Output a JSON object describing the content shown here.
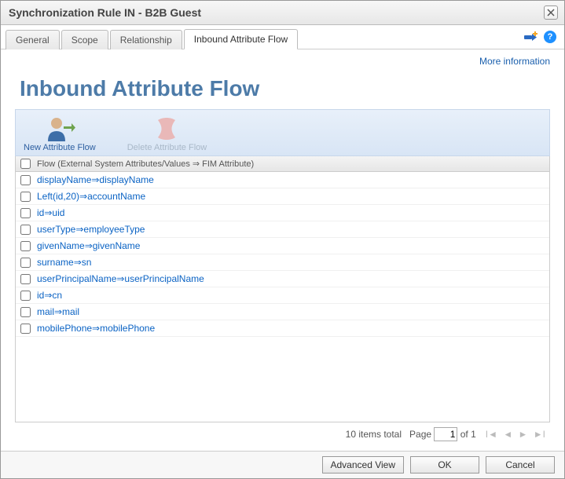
{
  "window": {
    "title": "Synchronization Rule IN - B2B Guest"
  },
  "tabs": [
    {
      "label": "General",
      "active": false
    },
    {
      "label": "Scope",
      "active": false
    },
    {
      "label": "Relationship",
      "active": false
    },
    {
      "label": "Inbound Attribute Flow",
      "active": true
    }
  ],
  "links": {
    "more_information": "More information"
  },
  "heading": "Inbound Attribute Flow",
  "toolbar": {
    "new_flow": "New Attribute Flow",
    "delete_flow": "Delete Attribute Flow"
  },
  "table": {
    "header": "Flow (External System Attributes/Values ⇒ FIM Attribute)",
    "rows": [
      "displayName⇒displayName",
      "Left(id,20)⇒accountName",
      "id⇒uid",
      "userType⇒employeeType",
      "givenName⇒givenName",
      "surname⇒sn",
      "userPrincipalName⇒userPrincipalName",
      "id⇒cn",
      "mail⇒mail",
      "mobilePhone⇒mobilePhone"
    ]
  },
  "pager": {
    "total_text": "10 items total",
    "page_label": "Page",
    "page_value": "1",
    "of_text": "of 1"
  },
  "footer": {
    "advanced_view": "Advanced View",
    "ok": "OK",
    "cancel": "Cancel"
  }
}
